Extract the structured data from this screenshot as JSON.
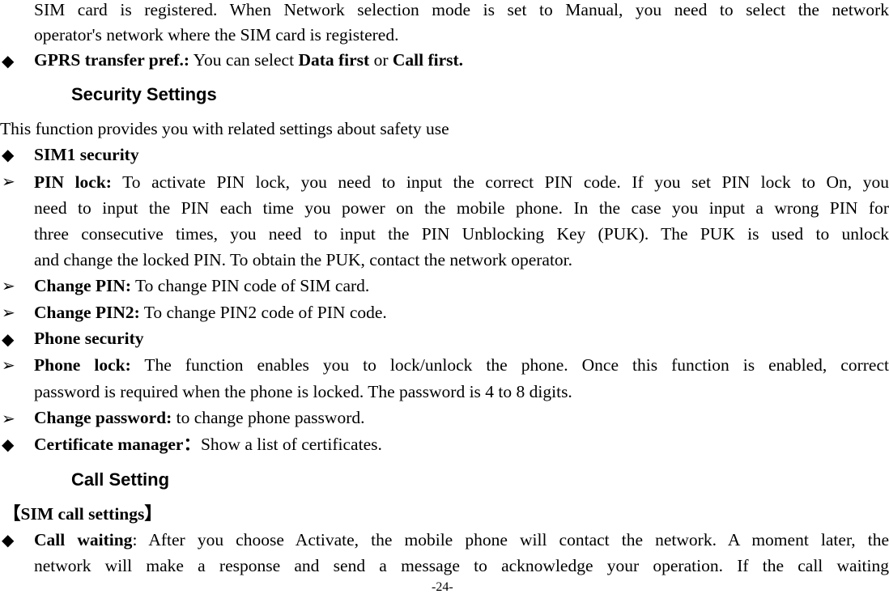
{
  "page_number": "-24-",
  "bullet_glyphs": {
    "diamond": "◆",
    "arrow": "➢"
  },
  "intro": {
    "line1": "SIM card is registered. When Network selection mode is set to Manual, you need to select the network",
    "line2": "operator's network where the SIM card is registered."
  },
  "gprs": {
    "label": "GPRS transfer pref.:",
    "text1": " You can select ",
    "opt1": "Data first",
    "text2": " or ",
    "opt2": "Call first."
  },
  "security": {
    "heading": "Security Settings",
    "intro": "This function provides you with related settings about safety use",
    "sim1": {
      "title": "SIM1 security",
      "items": [
        {
          "label": "PIN lock:",
          "lines": [
            " To activate PIN lock, you need to input the correct PIN code. If you set PIN lock to On, you",
            "need to input the PIN each time you power on the mobile phone. In the case you input a wrong PIN for",
            "three consecutive times, you need to input the PIN Unblocking Key (PUK). The PUK is used to unlock",
            "and change the locked PIN. To obtain the PUK, contact the network operator."
          ]
        },
        {
          "label": "Change PIN:",
          "lines": [
            " To change PIN code of SIM card."
          ]
        },
        {
          "label": "Change PIN2:",
          "lines": [
            " To change PIN2 code of PIN code."
          ]
        }
      ]
    },
    "phone": {
      "title": "Phone security",
      "items": [
        {
          "label": "Phone lock:",
          "lines": [
            " The function enables you to lock/unlock the phone. Once this function is enabled, correct",
            "password is required when the phone is locked. The password is 4 to 8 digits."
          ]
        },
        {
          "label": "Change password:",
          "lines": [
            " to change phone password."
          ]
        }
      ]
    },
    "certificate": {
      "label": "Certificate manager",
      "sep": "：",
      "text": "Show a list of certificates."
    }
  },
  "call": {
    "heading": "Call Setting",
    "sim_call_settings": "【SIM call settings】",
    "call_waiting": {
      "label": "Call waiting",
      "lines": [
        ": After you choose Activate, the mobile phone will contact the network. A moment later, the",
        "network will make a response and send a message to acknowledge your operation. If the call waiting"
      ]
    }
  }
}
